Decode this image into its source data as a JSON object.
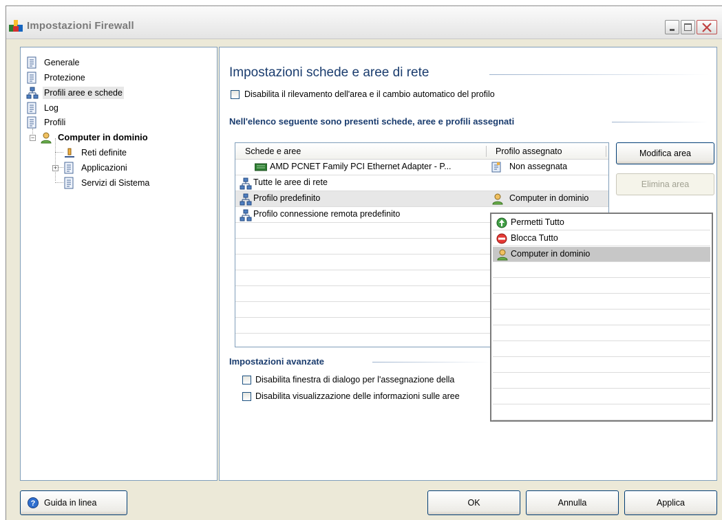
{
  "window": {
    "title": "Impostazioni Firewall"
  },
  "tree": {
    "items": [
      {
        "label": "Generale"
      },
      {
        "label": "Protezione"
      },
      {
        "label": "Profili aree e schede"
      },
      {
        "label": "Log"
      },
      {
        "label": "Profili"
      },
      {
        "label": "Computer in dominio"
      },
      {
        "label": "Reti definite"
      },
      {
        "label": "Applicazioni"
      },
      {
        "label": "Servizi di Sistema"
      }
    ]
  },
  "main": {
    "title": "Impostazioni schede e aree di rete",
    "disable_detection_label": "Disabilita il rilevamento dell'area e il cambio automatico del profilo",
    "list_heading": "Nell'elenco seguente sono presenti schede, aree e profili assegnati",
    "columns": [
      "Schede e aree",
      "Profilo assegnato"
    ],
    "rows": [
      {
        "name": "AMD PCNET Family PCI Ethernet Adapter - P...",
        "profile": "Non assegnata",
        "icon": "network-adapter-icon",
        "profile_icon": "unassigned-icon"
      },
      {
        "name": "Tutte le aree di rete",
        "profile": "",
        "icon": "network-icon",
        "profile_icon": ""
      },
      {
        "name": "Profilo predefinito",
        "profile": "Computer in dominio",
        "icon": "network-icon",
        "profile_icon": "user-icon"
      },
      {
        "name": "Profilo connessione remota predefinito",
        "profile": "",
        "icon": "network-icon",
        "profile_icon": ""
      }
    ],
    "buttons": {
      "modify_area": "Modifica area",
      "delete_area": "Elimina area"
    },
    "advanced": {
      "heading": "Impostazioni avanzate",
      "option1": "Disabilita finestra di dialogo per l'assegnazione della",
      "option2": "Disabilita visualizzazione delle informazioni sulle aree"
    },
    "profile_dropdown": {
      "options": [
        {
          "label": "Permetti Tutto",
          "icon": "allow-icon"
        },
        {
          "label": "Blocca Tutto",
          "icon": "block-icon"
        },
        {
          "label": "Computer in dominio",
          "icon": "user-icon",
          "selected": true
        }
      ]
    }
  },
  "footer": {
    "help": "Guida in linea",
    "ok": "OK",
    "cancel": "Annulla",
    "apply": "Applica"
  },
  "colors": {
    "heading": "#1a3c6e",
    "selection": "#e7e7e7",
    "border": "#7f9db9"
  }
}
